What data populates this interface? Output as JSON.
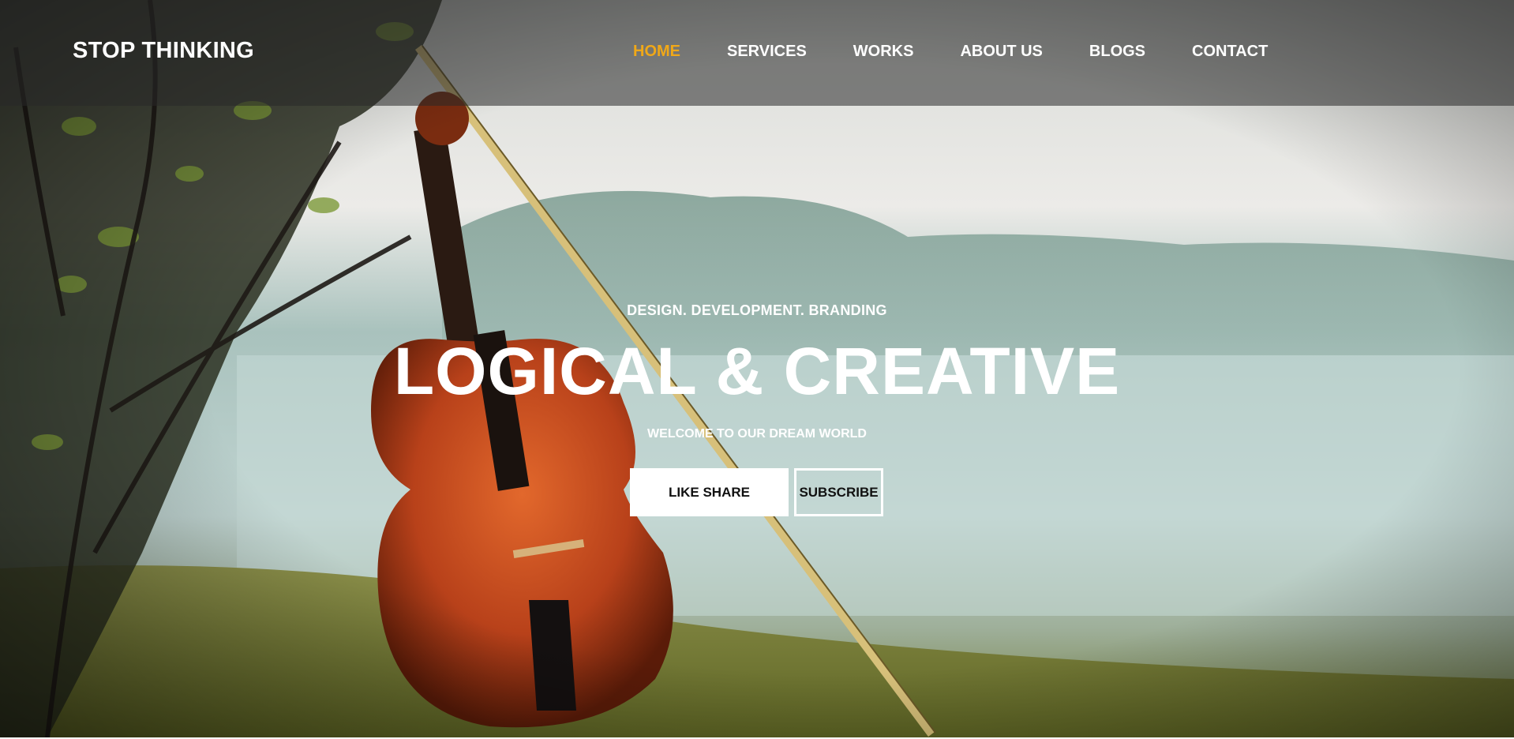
{
  "brand": {
    "logo_text": "STOP THINKING"
  },
  "nav": {
    "items": [
      {
        "label": "HOME",
        "active": true
      },
      {
        "label": "SERVICES",
        "active": false
      },
      {
        "label": "WORKS",
        "active": false
      },
      {
        "label": "ABOUT US",
        "active": false
      },
      {
        "label": "BLOGS",
        "active": false
      },
      {
        "label": "CONTACT",
        "active": false
      }
    ]
  },
  "hero": {
    "tagline": "DESIGN. DEVELOPMENT. BRANDING",
    "headline": "LOGICAL & CREATIVE",
    "subtitle": "WELCOME TO OUR DREAM WORLD",
    "primary_button": "LIKE SHARE",
    "secondary_button": "SUBSCRIBE",
    "background_image": "violin-on-grass-lakeside-photo"
  },
  "colors": {
    "accent": "#f0a818",
    "nav_text": "#ffffff",
    "nav_bar": "rgba(40,40,40,0.55)"
  }
}
